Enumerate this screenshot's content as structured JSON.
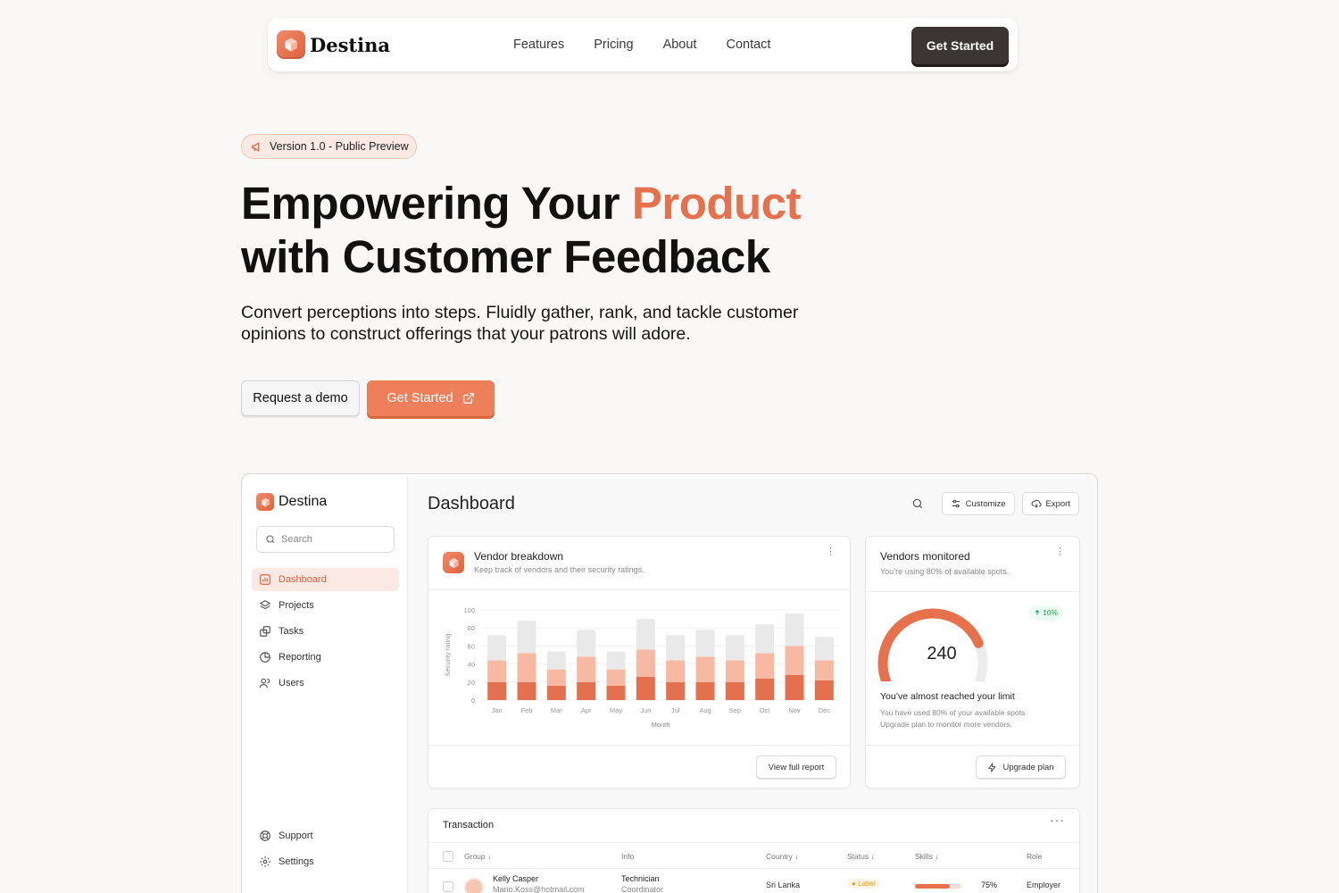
{
  "nav": {
    "brand": "Destina",
    "links": [
      "Features",
      "Pricing",
      "About",
      "Contact"
    ],
    "cta": "Get Started"
  },
  "hero": {
    "badge": "Version 1.0 - Public Preview",
    "title_part1": "Empowering Your ",
    "title_accent": "Product",
    "title_part2": "with Customer Feedback",
    "subtitle": "Convert perceptions into steps. Fluidly gather, rank, and tackle customer opinions to construct offerings that your patrons will adore.",
    "btn_demo": "Request a demo",
    "btn_start": "Get Started"
  },
  "colors": {
    "accent": "#e8714d",
    "bar_dark": "#e3714f",
    "bar_mid": "#f7b9a2",
    "bar_light": "#e9e9e9",
    "dark_button": "#3b3634",
    "success": "#16a34a"
  },
  "dashboard": {
    "brand": "Destina",
    "search_placeholder": "Search",
    "nav_items": [
      {
        "label": "Dashboard",
        "icon": "chart-icon",
        "active": true
      },
      {
        "label": "Projects",
        "icon": "layers-icon"
      },
      {
        "label": "Tasks",
        "icon": "copy-icon"
      },
      {
        "label": "Reporting",
        "icon": "pie-icon"
      },
      {
        "label": "Users",
        "icon": "users-icon"
      }
    ],
    "bottom_items": [
      {
        "label": "Support",
        "icon": "lifebuoy-icon"
      },
      {
        "label": "Settings",
        "icon": "gear-icon"
      }
    ],
    "title": "Dashboard",
    "customize": "Customize",
    "export": "Export",
    "vendor_card": {
      "title": "Vendor breakdown",
      "subtitle": "Keep track of vendors and their security ratings.",
      "button": "View full report"
    },
    "monitor_card": {
      "title": "Vendors monitored",
      "subtitle": "You’re using 80% of available spots.",
      "value": "240",
      "gauge_fraction": 0.8,
      "trend": "10%",
      "message_title": "You’ve almost reached your limit",
      "message_body_1": "You have used 80% of your available spots.",
      "message_body_2": "Upgrade plan to monitor more vendors.",
      "button": "Upgrade plan"
    },
    "transaction": {
      "title": "Transaction",
      "columns": [
        "Group",
        "Info",
        "Country",
        "Status",
        "Skills",
        "Role"
      ],
      "row": {
        "name": "Kelly Casper",
        "email": "Mario.Koss@hotmail.com",
        "info_1": "Technician",
        "info_2": "Coordinator",
        "country": "Sri Lanka",
        "status": "Label",
        "skill_value": 0.75,
        "skill_text": "75%",
        "role": "Employer"
      }
    }
  },
  "chart_data": {
    "type": "bar",
    "title": "",
    "xlabel": "Month",
    "ylabel": "Security rating",
    "ylim": [
      0,
      100
    ],
    "yticks": [
      0,
      20,
      40,
      60,
      80,
      100
    ],
    "categories": [
      "Jan",
      "Feb",
      "Mar",
      "Apr",
      "May",
      "Jun",
      "Jul",
      "Aug",
      "Sep",
      "Oct",
      "Nov",
      "Dec"
    ],
    "series": [
      {
        "values": [
          28,
          36,
          20,
          30,
          20,
          34,
          28,
          30,
          28,
          32,
          36,
          26
        ]
      },
      {
        "values": [
          24,
          32,
          18,
          28,
          18,
          30,
          24,
          28,
          24,
          28,
          32,
          22
        ]
      },
      {
        "values": [
          20,
          20,
          16,
          20,
          16,
          26,
          20,
          20,
          20,
          24,
          28,
          22
        ]
      }
    ]
  }
}
